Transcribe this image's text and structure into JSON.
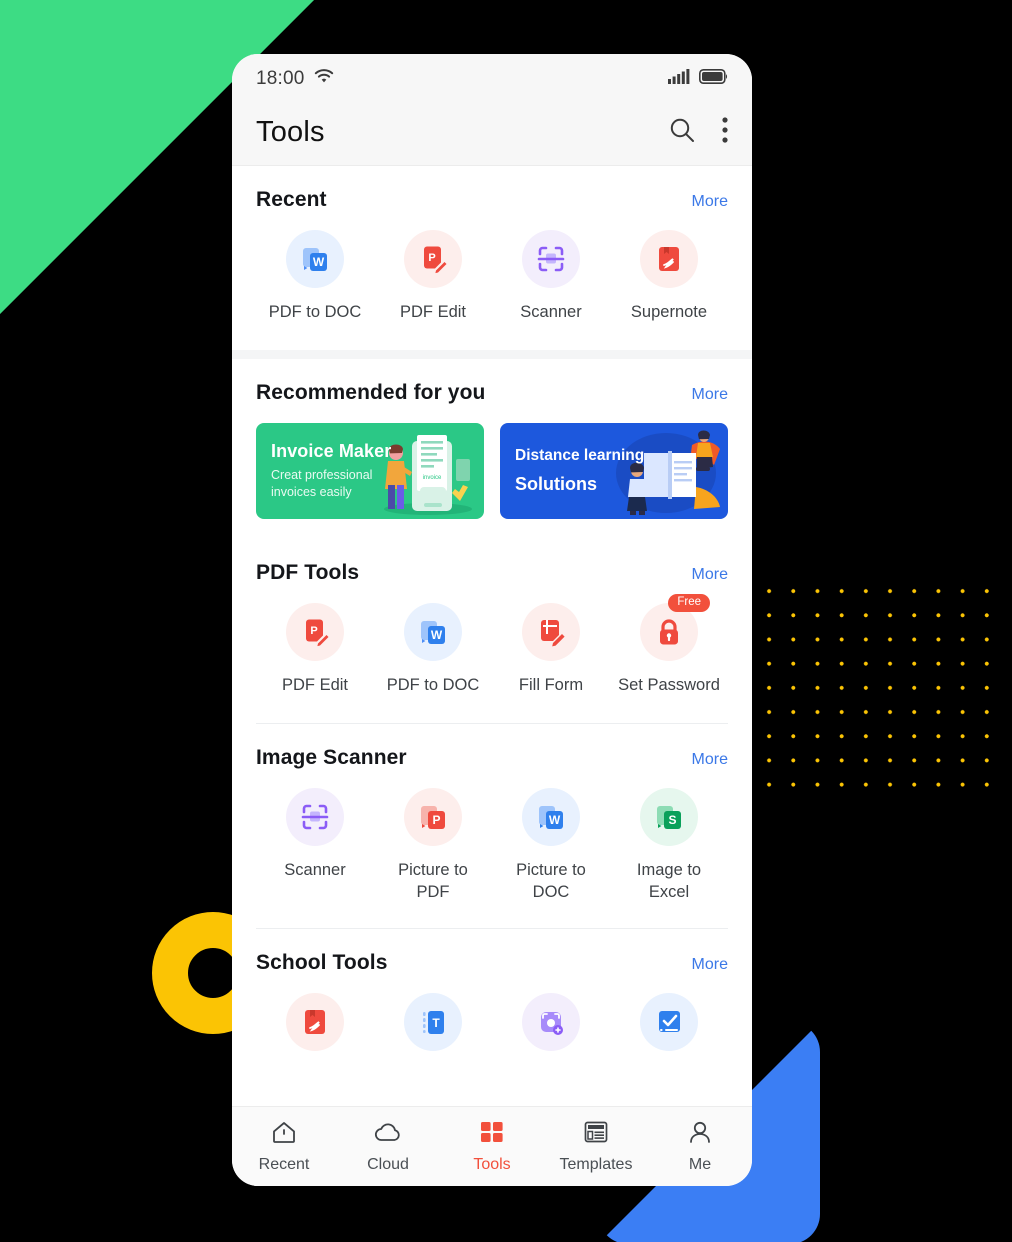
{
  "background": {
    "page_color": "#000000",
    "shapes": [
      {
        "name": "green-triangle",
        "color": "#3ddc84"
      },
      {
        "name": "yellow-ring",
        "color": "#fbc404"
      },
      {
        "name": "yellow-dot-grid",
        "color": "#fbc404"
      },
      {
        "name": "blue-triangle",
        "color": "#3b7ef4"
      }
    ]
  },
  "status_bar": {
    "time": "18:00",
    "wifi_icon": "wifi-icon",
    "signal_icon": "signal-bars-icon",
    "battery_icon": "battery-full-icon"
  },
  "app_bar": {
    "title": "Tools",
    "search_icon": "search-icon",
    "overflow_icon": "more-vertical-icon"
  },
  "sections": [
    {
      "id": "recent",
      "title": "Recent",
      "more_label": "More",
      "tools": [
        {
          "label": "PDF to DOC",
          "icon": "pdf-to-doc-icon",
          "bg": "#e8f1fe",
          "badge": null
        },
        {
          "label": "PDF Edit",
          "icon": "pdf-edit-icon",
          "bg": "#fdeeec",
          "badge": null
        },
        {
          "label": "Scanner",
          "icon": "scanner-icon",
          "bg": "#f3eefc",
          "badge": null
        },
        {
          "label": "Supernote",
          "icon": "supernote-icon",
          "bg": "#fdeeec",
          "badge": null
        }
      ]
    },
    {
      "id": "recommended",
      "title": "Recommended for you",
      "more_label": "More",
      "banners": [
        {
          "title": "Invoice Maker",
          "subtitle": "Creat professional\ninvoices easily",
          "color": "#2bc886",
          "art": "invoice-illustration"
        },
        {
          "line1": "Distance learning",
          "line2": "Solutions",
          "color": "#1d58dd",
          "art": "distance-learning-illustration"
        }
      ]
    },
    {
      "id": "pdf-tools",
      "title": "PDF Tools",
      "more_label": "More",
      "tools": [
        {
          "label": "PDF Edit",
          "icon": "pdf-edit-icon",
          "bg": "#fdeeec",
          "badge": null
        },
        {
          "label": "PDF to DOC",
          "icon": "pdf-to-doc-icon",
          "bg": "#e8f1fe",
          "badge": null
        },
        {
          "label": "Fill Form",
          "icon": "fill-form-icon",
          "bg": "#fdeeec",
          "badge": null
        },
        {
          "label": "Set Password",
          "icon": "set-password-icon",
          "bg": "#fdeeec",
          "badge": "Free"
        }
      ]
    },
    {
      "id": "image-scanner",
      "title": "Image Scanner",
      "more_label": "More",
      "tools": [
        {
          "label": "Scanner",
          "icon": "scanner-icon",
          "bg": "#f3eefc",
          "badge": null
        },
        {
          "label": "Picture to PDF",
          "icon": "picture-to-pdf-icon",
          "bg": "#fdeeec",
          "badge": null
        },
        {
          "label": "Picture to DOC",
          "icon": "picture-to-doc-icon",
          "bg": "#e8f1fe",
          "badge": null
        },
        {
          "label": "Image to Excel",
          "icon": "image-to-excel-icon",
          "bg": "#e6f7ee",
          "badge": null
        }
      ]
    },
    {
      "id": "school-tools",
      "title": "School Tools",
      "more_label": "More",
      "tools": [
        {
          "label": "",
          "icon": "supernote-icon",
          "bg": "#fdeeec",
          "badge": null
        },
        {
          "label": "",
          "icon": "text-tool-icon",
          "bg": "#e8f1fe",
          "badge": null
        },
        {
          "label": "",
          "icon": "photo-scan-icon",
          "bg": "#f3eefc",
          "badge": null
        },
        {
          "label": "",
          "icon": "checklist-icon",
          "bg": "#e8f1fe",
          "badge": null
        }
      ]
    }
  ],
  "bottom_nav": {
    "active": "Tools",
    "accent_color": "#f2503c",
    "items": [
      {
        "label": "Recent",
        "icon": "home-icon"
      },
      {
        "label": "Cloud",
        "icon": "cloud-icon"
      },
      {
        "label": "Tools",
        "icon": "grid-icon"
      },
      {
        "label": "Templates",
        "icon": "templates-icon"
      },
      {
        "label": "Me",
        "icon": "person-icon"
      }
    ]
  }
}
